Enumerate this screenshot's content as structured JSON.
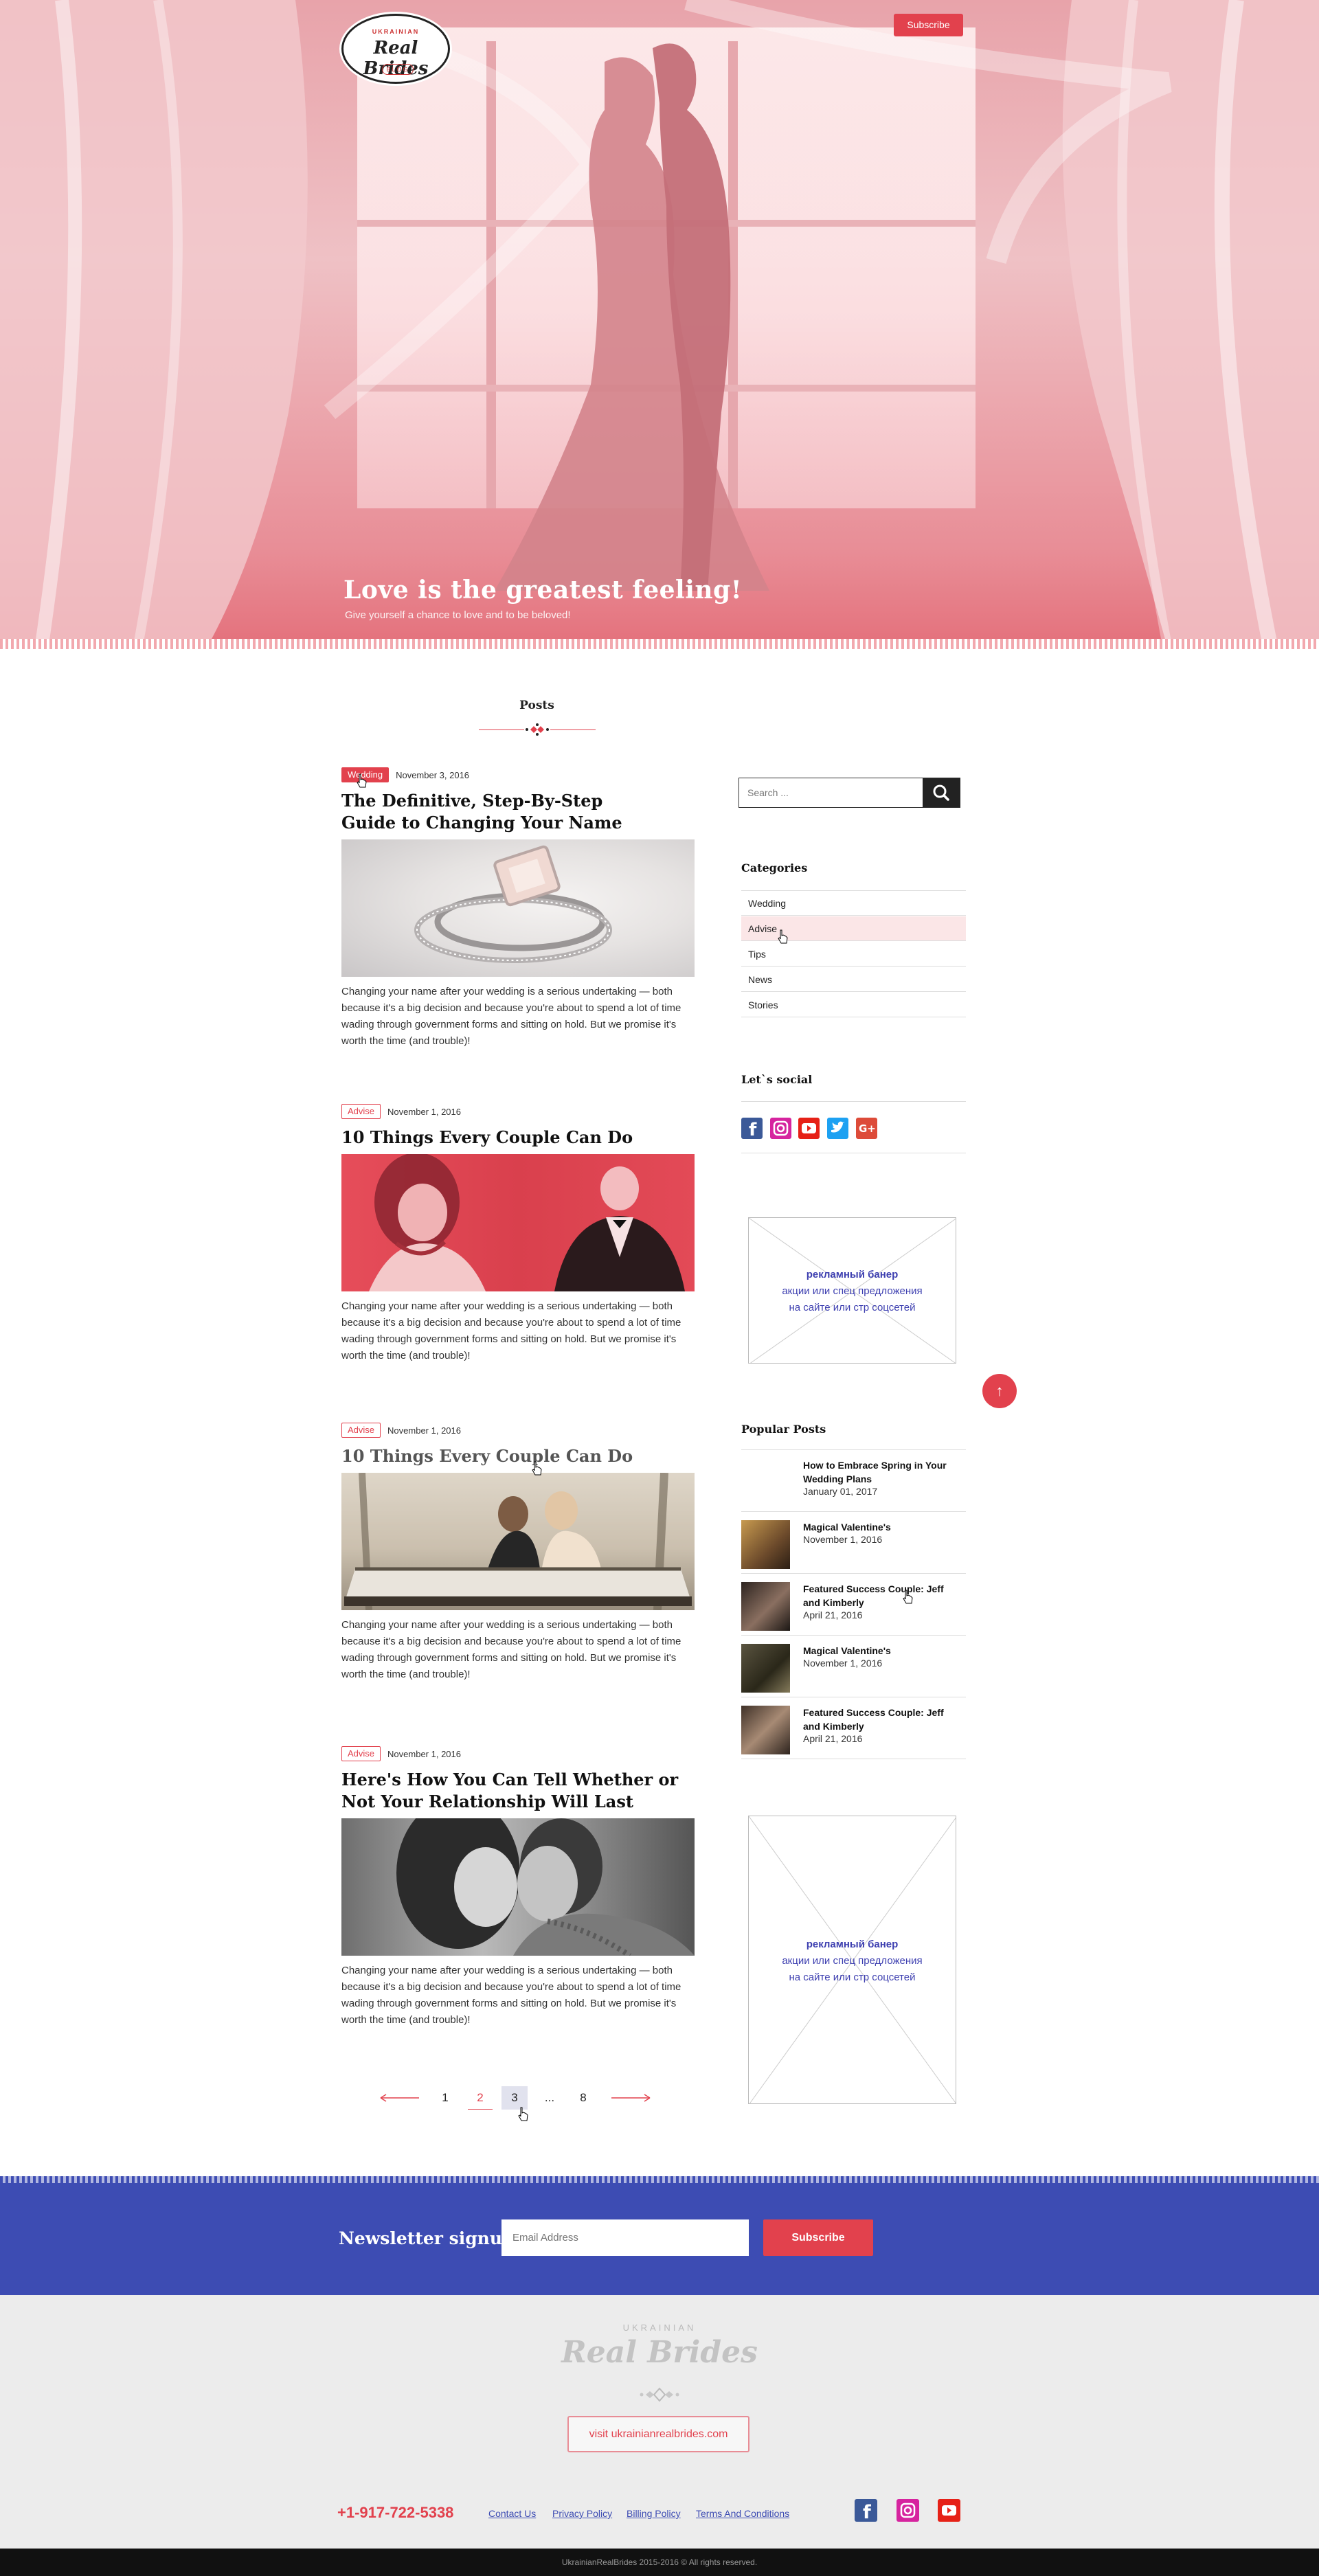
{
  "header": {
    "logo_small": "UKRAINIAN",
    "logo_big": "Real Brides",
    "logo_blog": "BLOG",
    "subscribe_label": "Subscribe"
  },
  "hero": {
    "title": "Love is the greatest feeling!",
    "subtitle": "Give yourself a chance to love and to be beloved!"
  },
  "posts_heading": "Posts",
  "posts": [
    {
      "tag": "Wedding",
      "date": "November 3, 2016",
      "title": "The Definitive, Step-By-Step Guide to Changing Your Name",
      "excerpt": "Changing your name after your wedding is a serious undertaking — both because it's a big decision and because you're about to spend a lot of time wading through government forms and sitting on hold. But we promise it's worth the time (and trouble)!"
    },
    {
      "tag": "Advise",
      "date": "November 1, 2016",
      "title": "10 Things Every Couple Can Do",
      "excerpt": "Changing your name after your wedding is a serious undertaking — both because it's a big decision and because you're about to spend a lot of time wading through government forms and sitting on hold. But we promise it's worth the time (and trouble)!"
    },
    {
      "tag": "Advise",
      "date": "November 1, 2016",
      "title": "10 Things Every Couple Can Do",
      "excerpt": "Changing your name after your wedding is a serious undertaking — both because it's a big decision and because you're about to spend a lot of time wading through government forms and sitting on hold. But we promise it's worth the time (and trouble)!"
    },
    {
      "tag": "Advise",
      "date": "November 1, 2016",
      "title": "Here's How You Can Tell Whether or Not Your Relationship Will Last",
      "excerpt": "Changing your name after your wedding is a serious undertaking — both because it's a big decision and because you're about to spend a lot of time wading through government forms and sitting on hold. But we promise it's worth the time (and trouble)!"
    }
  ],
  "sidebar": {
    "search_placeholder": "Search ...",
    "categories_heading": "Categories",
    "categories": [
      "Wedding",
      "Advise",
      "Tips",
      "News",
      "Stories"
    ],
    "social_heading": "Let`s social",
    "social_icons": [
      "facebook-icon",
      "instagram-icon",
      "youtube-icon",
      "twitter-icon",
      "google-plus-icon"
    ],
    "banner": {
      "line1": "рекламный банер",
      "line2": "акции или спец предложения",
      "line3": "на сайте или стр соцсетей"
    },
    "popular_heading": "Popular Posts",
    "popular": [
      {
        "title": "How to Embrace Spring in Your Wedding Plans",
        "date": "January 01, 2017"
      },
      {
        "title": "Magical Valentine's",
        "date": "November 1, 2016"
      },
      {
        "title": "Featured Success Couple: Jeff and Kimberly",
        "date": "April 21, 2016"
      },
      {
        "title": "Magical Valentine's",
        "date": "November 1, 2016"
      },
      {
        "title": "Featured Success Couple: Jeff and Kimberly",
        "date": "April 21, 2016"
      }
    ]
  },
  "pagination": {
    "pages": [
      "1",
      "2",
      "3",
      "...",
      "8"
    ],
    "current": "3"
  },
  "scroll_top_label": "↑",
  "newsletter": {
    "label": "Newsletter signup",
    "placeholder": "Email Address",
    "button": "Subscribe"
  },
  "footer": {
    "logo_small": "UKRAINIAN",
    "logo_big": "Real Brides",
    "visit": "visit ukrainianrealbrides.com",
    "phone": "+1-917-722-5338",
    "links": [
      "Contact Us",
      "Privacy Policy",
      "Billing Policy",
      "Terms And Conditions"
    ],
    "copyright": "UkrainianRealBrides 2015-2016 © All rights reserved."
  },
  "colors": {
    "accent": "#e2414d",
    "newsletter_bg": "#3d4cb3",
    "footer_bg": "#ececec"
  }
}
